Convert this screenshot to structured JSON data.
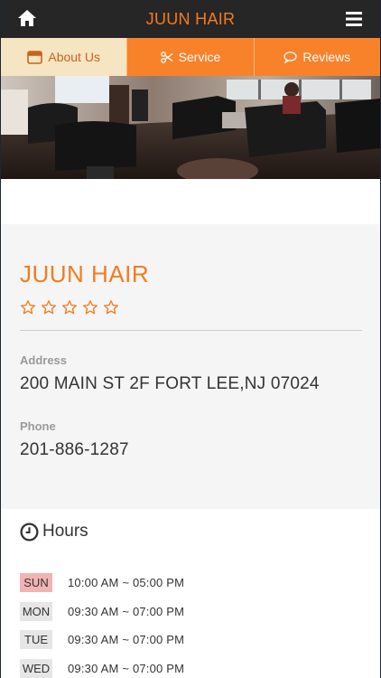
{
  "header": {
    "title": "JUUN HAIR",
    "home_icon": "home-icon",
    "menu_icon": "hamburger-menu-icon"
  },
  "tabs": [
    {
      "label": "About Us",
      "icon": "store-icon",
      "active": true
    },
    {
      "label": "Service",
      "icon": "scissors-icon",
      "active": false
    },
    {
      "label": "Reviews",
      "icon": "speech-bubble-icon",
      "active": false
    }
  ],
  "shop": {
    "name": "JUUN HAIR",
    "rating": 0,
    "rating_max": 5,
    "address_label": "Address",
    "address": "200 MAIN ST 2F FORT LEE,NJ 07024",
    "phone_label": "Phone",
    "phone": "201-886-1287"
  },
  "hours": {
    "title": "Hours",
    "rows": [
      {
        "day": "SUN",
        "time": "10:00 AM ~ 05:00 PM",
        "highlight": true
      },
      {
        "day": "MON",
        "time": "09:30 AM ~ 07:00 PM",
        "highlight": false
      },
      {
        "day": "TUE",
        "time": "09:30 AM ~ 07:00 PM",
        "highlight": false
      },
      {
        "day": "WED",
        "time": "09:30 AM ~ 07:00 PM",
        "highlight": false
      }
    ]
  },
  "colors": {
    "accent": "#f47b20",
    "header_bg": "#262626",
    "tab_bg": "#f7822a",
    "tab_active_bg": "#f6e5c3",
    "today_badge": "#f2b3b3"
  }
}
